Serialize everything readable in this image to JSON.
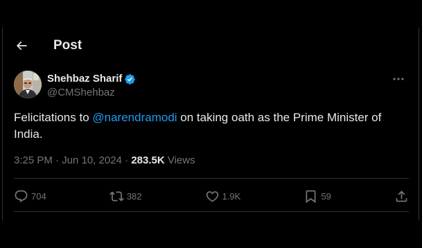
{
  "header": {
    "back_icon": "arrow-left-icon",
    "title": "Post"
  },
  "author": {
    "display_name": "Shehbaz Sharif",
    "handle": "@CMShehbaz",
    "verified_icon": "verified-badge-icon",
    "verified_color": "#1d9bf0"
  },
  "tweet": {
    "text_before": "Felicitations to ",
    "mention": "@narendramodi",
    "text_after": " on taking oath as the Prime Minister of India."
  },
  "meta": {
    "time": "3:25 PM",
    "date_sep": " · ",
    "date": "Jun 10, 2024",
    "views_sep": " · ",
    "views_count": "283.5K",
    "views_label": " Views"
  },
  "actions": {
    "replies": "704",
    "reposts": "382",
    "likes": "1.9K",
    "bookmarks": "59"
  },
  "colors": {
    "background": "#000000",
    "text": "#e7e9ea",
    "muted": "#71767b",
    "accent": "#1d9bf0",
    "border": "#2f3336"
  }
}
